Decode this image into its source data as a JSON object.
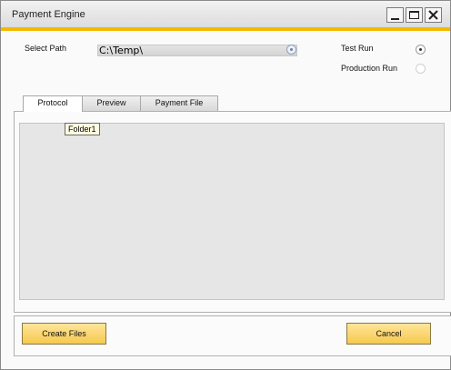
{
  "window": {
    "title": "Payment Engine"
  },
  "form": {
    "select_path_label": "Select Path",
    "select_path_value": "C:\\Temp\\",
    "test_run_label": "Test Run",
    "test_run_selected": true,
    "production_run_label": "Production Run",
    "production_run_selected": false
  },
  "tabs": [
    {
      "label": "Protocol",
      "active": true
    },
    {
      "label": "Preview",
      "active": false
    },
    {
      "label": "Payment File",
      "active": false
    }
  ],
  "protocol": {
    "tooltip": "Folder1"
  },
  "buttons": {
    "create_files": "Create Files",
    "cancel": "Cancel"
  },
  "colors": {
    "accent": "#f5b800",
    "button": "#f6c94e"
  }
}
